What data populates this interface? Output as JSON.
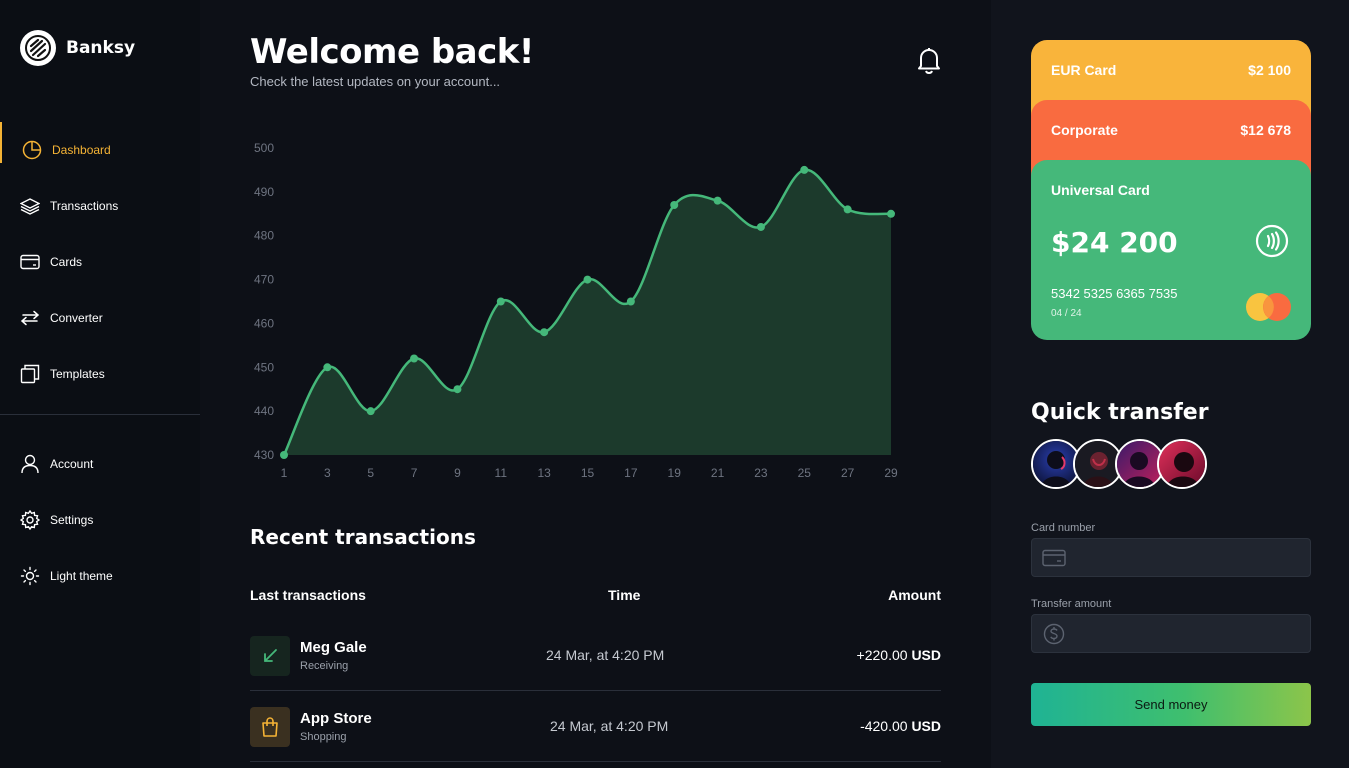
{
  "brand": {
    "name": "Banksy",
    "logo_icon": "banksy-logo-icon"
  },
  "sidebar": {
    "items": [
      {
        "label": "Dashboard",
        "icon": "pie-chart-icon",
        "active": true
      },
      {
        "label": "Transactions",
        "icon": "layers-icon"
      },
      {
        "label": "Cards",
        "icon": "credit-card-icon"
      },
      {
        "label": "Converter",
        "icon": "arrows-exchange-icon"
      },
      {
        "label": "Templates",
        "icon": "copy-icon"
      }
    ],
    "bottom": [
      {
        "label": "Account",
        "icon": "user-icon"
      },
      {
        "label": "Settings",
        "icon": "gear-icon"
      },
      {
        "label": "Light theme",
        "icon": "sun-icon"
      }
    ],
    "active_color": "#f5b335"
  },
  "header": {
    "title": "Welcome back!",
    "subtitle": "Check the latest updates on your account...",
    "bell_icon": "bell-icon"
  },
  "chart_data": {
    "type": "area",
    "x": [
      1,
      3,
      5,
      7,
      9,
      11,
      13,
      15,
      17,
      19,
      21,
      23,
      25,
      27,
      29
    ],
    "values": [
      430,
      450,
      440,
      452,
      445,
      465,
      458,
      470,
      465,
      487,
      488,
      482,
      495,
      486,
      485
    ],
    "xticks": [
      "1",
      "3",
      "5",
      "7",
      "9",
      "11",
      "13",
      "15",
      "17",
      "19",
      "21",
      "23",
      "25",
      "27",
      "29"
    ],
    "yticks": [
      "430",
      "440",
      "450",
      "460",
      "470",
      "480",
      "490",
      "500"
    ],
    "ylim": [
      430,
      500
    ],
    "xlim": [
      1,
      29
    ],
    "line_color": "#45b87a",
    "fill_color": "#1c3a2c",
    "grid": false
  },
  "transactions": {
    "title": "Recent transactions",
    "columns": [
      "Last transactions",
      "Time",
      "Amount"
    ],
    "rows": [
      {
        "name": "Meg Gale",
        "category": "Receiving",
        "time": "24 Mar, at 4:20 PM",
        "amount": "+220.00",
        "currency": "USD",
        "icon": "arrow-down-left-icon",
        "icon_color": "#45b87a",
        "icon_bg": "#16251f"
      },
      {
        "name": "App Store",
        "category": "Shopping",
        "time": "24 Mar, at 4:20 PM",
        "amount": "-420.00",
        "currency": "USD",
        "icon": "shopping-bag-icon",
        "icon_color": "#f5b335",
        "icon_bg": "#3a3020"
      }
    ]
  },
  "cards": [
    {
      "label": "EUR Card",
      "value": "$2 100",
      "color": "#f9b43b"
    },
    {
      "label": "Corporate",
      "value": "$12 678",
      "color": "#f96b40"
    },
    {
      "label": "Universal Card",
      "balance": "$24 200",
      "number": "5342 5325 6365 7535",
      "expiry": "04 / 24",
      "color": "#45b87a",
      "contactless_icon": "contactless-icon",
      "brand_icon": "mastercard-icon"
    }
  ],
  "quick_transfer": {
    "title": "Quick transfer",
    "contacts": [
      "contact-avatar-1",
      "contact-avatar-2",
      "contact-avatar-3",
      "contact-avatar-4"
    ],
    "card_number_label": "Card number",
    "card_number_value": "",
    "transfer_amount_label": "Transfer amount",
    "transfer_amount_value": "",
    "send_label": "Send money"
  }
}
